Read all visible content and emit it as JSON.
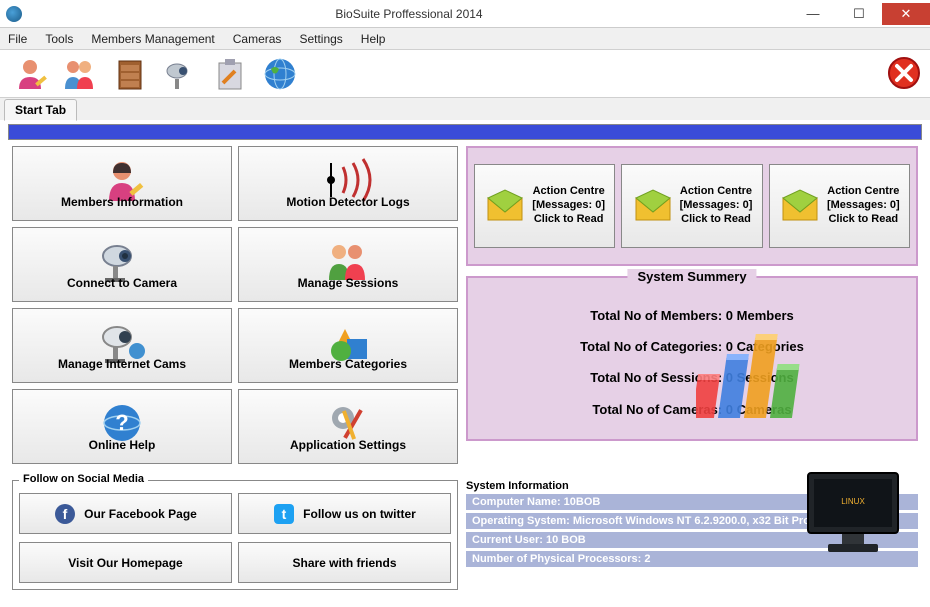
{
  "window": {
    "title": "BioSuite Proffessional 2014"
  },
  "menu": {
    "file": "File",
    "tools": "Tools",
    "members": "Members Management",
    "cameras": "Cameras",
    "settings": "Settings",
    "help": "Help"
  },
  "tab": {
    "start": "Start Tab"
  },
  "left_buttons": {
    "members_info": "Members Information",
    "motion_logs": "Motion Detector Logs",
    "connect_camera": "Connect to Camera",
    "manage_sessions": "Manage Sessions",
    "manage_internet_cams": "Manage Internet Cams",
    "members_categories": "Members Categories",
    "online_help": "Online Help",
    "app_settings": "Application Settings"
  },
  "action_centre": {
    "title": "Action Centre",
    "messages": "[Messages: 0]",
    "click": "Click to Read"
  },
  "summary": {
    "legend": "System Summery",
    "members": "Total No of Members: 0 Members",
    "categories": "Total No of Categories: 0 Categories",
    "sessions": "Total No of Sessions: 0 Sessions",
    "cameras": "Total No of Cameras: 0 Cameras"
  },
  "social": {
    "legend": "Follow on Social Media",
    "facebook": "Our Facebook Page",
    "twitter": "Follow us on twitter",
    "homepage": "Visit Our Homepage",
    "share": "Share with friends"
  },
  "sysinfo": {
    "legend": "System Information",
    "computer": "Computer Name: 10BOB",
    "os": "Operating System: Microsoft Windows NT 6.2.9200.0, x32 Bit Processor",
    "user": "Current User: 10 BOB",
    "processors": "Number of Physical Processors: 2"
  }
}
